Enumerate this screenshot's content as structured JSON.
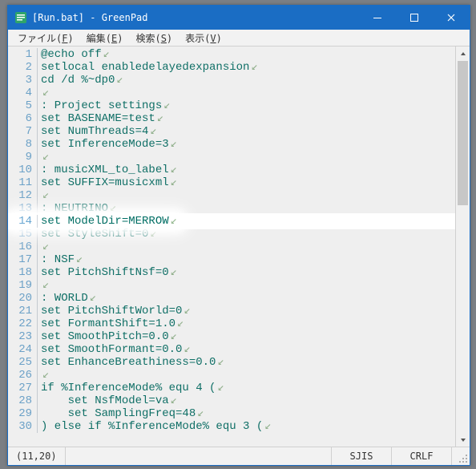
{
  "colors": {
    "accent": "#1a6dc4",
    "code": "#006e64",
    "gutter": "#6aa7d2"
  },
  "title": "[Run.bat] - GreenPad",
  "menu": {
    "file": {
      "label": "ファイル",
      "accel": "F"
    },
    "edit": {
      "label": "編集",
      "accel": "E"
    },
    "search": {
      "label": "検索",
      "accel": "S"
    },
    "view": {
      "label": "表示",
      "accel": "V"
    }
  },
  "code": {
    "highlight_line": 14,
    "lines": [
      "@echo off",
      "setlocal enabledelayedexpansion",
      "cd /d %~dp0",
      "",
      ": Project settings",
      "set BASENAME=test",
      "set NumThreads=4",
      "set InferenceMode=3",
      "",
      ": musicXML_to_label",
      "set SUFFIX=musicxml",
      "",
      ": NEUTRINO",
      "set ModelDir=MERROW",
      "set StyleShift=0",
      "",
      ": NSF",
      "set PitchShiftNsf=0",
      "",
      ": WORLD",
      "set PitchShiftWorld=0",
      "set FormantShift=1.0",
      "set SmoothPitch=0.0",
      "set SmoothFormant=0.0",
      "set EnhanceBreathiness=0.0",
      "",
      "if %InferenceMode% equ 4 (",
      "    set NsfModel=va",
      "    set SamplingFreq=48",
      ") else if %InferenceMode% equ 3 ("
    ]
  },
  "status": {
    "cursor": "(11,20)",
    "encoding": "SJIS",
    "line_ending": "CRLF"
  },
  "eol_char": "↙"
}
